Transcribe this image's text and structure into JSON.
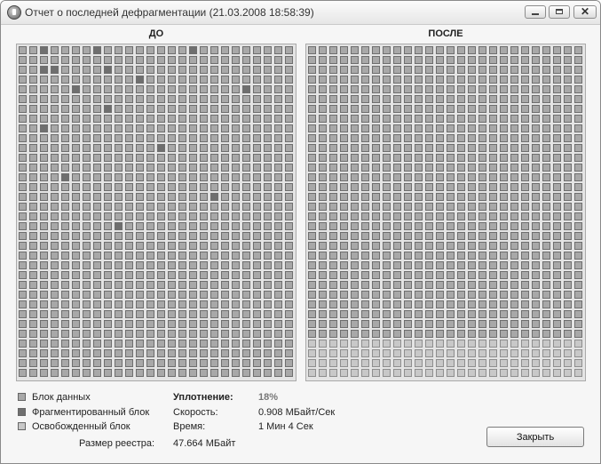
{
  "window": {
    "title": "Отчет о последней дефрагментации (21.03.2008 18:58:39)",
    "close_glyph": "✕"
  },
  "maps": {
    "before": {
      "label": "ДО",
      "rows": [
        "DDFDDDDFDDDDDDDDFDDDDDDDDD",
        "DDDDDDDDDDDDDDDDDDDDDDDDDD",
        "DDFFDDDDFDDDDDDDDDDDDDDDDD",
        "DDDDDDDDDDDFDDDDDDDDDDDDDD",
        "DDDDDFDDDDDDDDDDDDDDDFDDDD",
        "DDDDDDDDDDDDDDDDDDDDDDDDDD",
        "DDDDDDDDFDDDDDDDDDDDDDDDDD",
        "DDDDDDDDDDDDDDDDDDDDDDDDDD",
        "DDFDDDDDDDDDDDDDDDDDDDDDDD",
        "DDDDDDDDDDDDDDDDDDDDDDDDDD",
        "DDDDDDDDDDDDDFDDDDDDDDDDDD",
        "DDDDDDDDDDDDDDDDDDDDDDDDDD",
        "DDDDDDDDDDDDDDDDDDDDDDDDDD",
        "DDDDFDDDDDDDDDDDDDDDDDDDDD",
        "DDDDDDDDDDDDDDDDDDDDDDDDDD",
        "DDDDDDDDDDDDDDDDDDFDDDDDDD",
        "DDDDDDDDDDDDDDDDDDDDDDDDDD",
        "DDDDDDDDDDDDDDDDDDDDDDDDDD",
        "DDDDDDDDDFDDDDDDDDDDDDDDDD",
        "DDDDDDDDDDDDDDDDDDDDDDDDDD",
        "DDDDDDDDDDDDDDDDDDDDDDDDDD",
        "DDDDDDDDDDDDDDDDDDDDDDDDDD",
        "DDDDDDDDDDDDDDDDDDDDDDDDDD",
        "DDDDDDDDDDDDDDDDDDDDDDDDDD",
        "DDDDDDDDDDDDDDDDDDDDDDDDDD",
        "DDDDDDDDDDDDDDDDDDDDDDDDDD",
        "DDDDDDDDDDDDDDDDDDDDDDDDDD",
        "DDDDDDDDDDDDDDDDDDDDDDDDDD",
        "DDDDDDDDDDDDDDDDDDDDDDDDDD",
        "DDDDDDDDDDDDDDDDDDDDDDDDDD",
        "DDDDDDDDDDDDDDDDDDDDDDDDDD",
        "DDDDDDDDDDDDDDDDDDDDDDDDDD",
        "DDDDDDDDDDDDDDDDDDDDDDDDDD",
        "DDDDDDDDDDDDDDDDDDDDDDDDDD"
      ]
    },
    "after": {
      "label": "ПОСЛЕ",
      "rows": [
        "DDDDDDDDDDDDDDDDDDDDDDDDDD",
        "DDDDDDDDDDDDDDDDDDDDDDDDDD",
        "DDDDDDDDDDDDDDDDDDDDDDDDDD",
        "DDDDDDDDDDDDDDDDDDDDDDDDDD",
        "DDDDDDDDDDDDDDDDDDDDDDDDDD",
        "DDDDDDDDDDDDDDDDDDDDDDDDDD",
        "DDDDDDDDDDDDDDDDDDDDDDDDDD",
        "DDDDDDDDDDDDDDDDDDDDDDDDDD",
        "DDDDDDDDDDDDDDDDDDDDDDDDDD",
        "DDDDDDDDDDDDDDDDDDDDDDDDDD",
        "DDDDDDDDDDDDDDDDDDDDDDDDDD",
        "DDDDDDDDDDDDDDDDDDDDDDDDDD",
        "DDDDDDDDDDDDDDDDDDDDDDDDDD",
        "DDDDDDDDDDDDDDDDDDDDDDDDDD",
        "DDDDDDDDDDDDDDDDDDDDDDDDDD",
        "DDDDDDDDDDDDDDDDDDDDDDDDDD",
        "DDDDDDDDDDDDDDDDDDDDDDDDDD",
        "DDDDDDDDDDDDDDDDDDDDDDDDDD",
        "DDDDDDDDDDDDDDDDDDDDDDDDDD",
        "DDDDDDDDDDDDDDDDDDDDDDDDDD",
        "DDDDDDDDDDDDDDDDDDDDDDDDDD",
        "DDDDDDDDDDDDDDDDDDDDDDDDDD",
        "DDDDDDDDDDDDDDDDDDDDDDDDDD",
        "DDDDDDDDDDDDDDDDDDDDDDDDDD",
        "DDDDDDDDDDDDDDDDDDDDDDDDDD",
        "DDDDDDDDDDDDDDDDDDDDDDDDDD",
        "DDDDDDDDDDDDDDDDDDDDDDDDDD",
        "DDDDDDDDDDDDDDDDDDDDDDDDDD",
        "DDDDDDDDDDDDDDDDDDDDDDDDDD",
        "DDDDDDDDDDDDDDDDDDDDDDDDDD",
        "EEEEEEEEEEEEEEEEEEEEEEEEEE",
        "EEEEEEEEEEEEEEEEEEEEEEEEEE",
        "EEEEEEEEEEEEEEEEEEEEEEEEEE",
        "EEEEEEEEEEEEEEEEEEEEEEEEEE"
      ]
    }
  },
  "legend": {
    "data_block": "Блок данных",
    "fragmented_block": "Фрагментированный блок",
    "freed_block": "Освобожденный блок"
  },
  "stats": {
    "compaction_label": "Уплотнение:",
    "compaction_value": "18%",
    "speed_label": "Скорость:",
    "speed_value": "0.908 МБайт/Сек",
    "time_label": "Время:",
    "time_value": "1 Мин 4 Сек",
    "registry_size_label": "Размер реестра:",
    "registry_size_value": "47.664 МБайт"
  },
  "buttons": {
    "close": "Закрыть"
  },
  "colors": {
    "data_block": "#a8a8a8",
    "fragmented_block": "#6f6f6f",
    "freed_block": "#c8c8c8"
  }
}
